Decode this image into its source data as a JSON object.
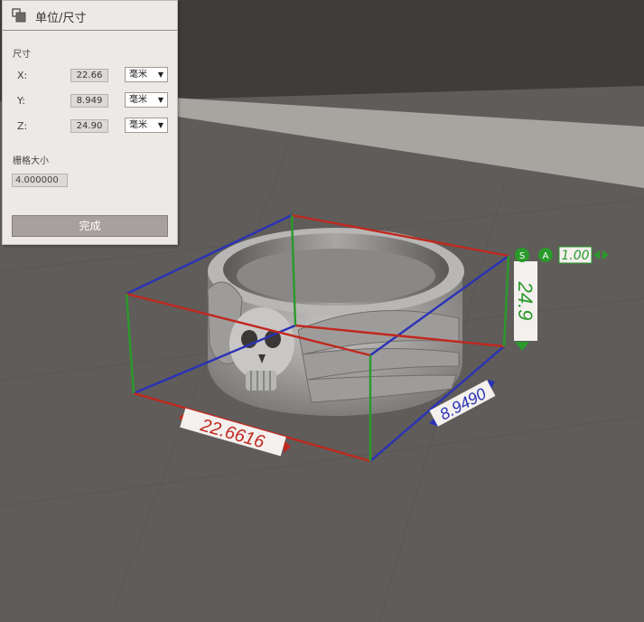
{
  "panel": {
    "title": "单位/尺寸",
    "size_section_label": "尺寸",
    "dimensions": [
      {
        "axis": "X:",
        "value": "22.66",
        "unit": "毫米"
      },
      {
        "axis": "Y:",
        "value": "8.949",
        "unit": "毫米"
      },
      {
        "axis": "Z:",
        "value": "24.90",
        "unit": "毫米"
      }
    ],
    "grid_label": "栅格大小",
    "grid_value": "4.000000",
    "done_label": "完成"
  },
  "viewport": {
    "x_measure": "22.6616",
    "y_measure": "8.9490",
    "z_measure": "24.9",
    "scale_value": "1.00",
    "badge_s": "S",
    "badge_a": "A"
  },
  "colors": {
    "x_axis": "#c0281e",
    "y_axis": "#2a32b5",
    "z_axis": "#2a9a2a",
    "panel_bg": "#ece9e6"
  }
}
